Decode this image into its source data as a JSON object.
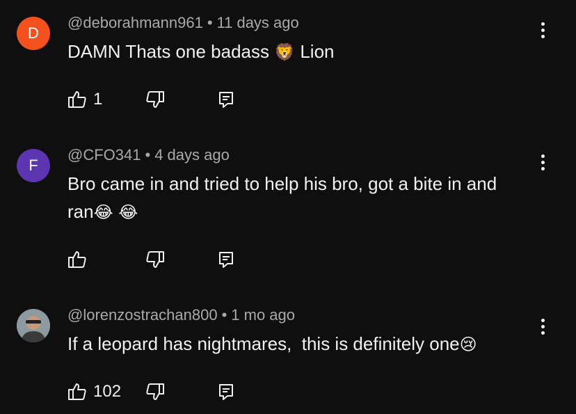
{
  "comments": [
    {
      "avatar_letter": "D",
      "avatar_color": "#f4511e",
      "handle": "@deborahmann961",
      "separator": "•",
      "time": "11 days ago",
      "text_before": "DAMN Thats one badass ",
      "emoji": "🦁",
      "text_after": " Lion",
      "like_count": "1"
    },
    {
      "avatar_letter": "F",
      "avatar_color": "#5e35b1",
      "handle": "@CFO341",
      "separator": "•",
      "time": "4 days ago",
      "text_before": "Bro came in and tried to help his bro, got a bite in and ran",
      "emoji": "😂 😂",
      "text_after": "",
      "like_count": ""
    },
    {
      "avatar_letter": "",
      "avatar_color": "#6b7a80",
      "handle": "@lorenzostrachan800",
      "separator": "•",
      "time": "1 mo ago",
      "text_before": "If a leopard has nightmares,  this is definitely one",
      "emoji": "😢",
      "text_after": "",
      "like_count": "102"
    }
  ],
  "icons": {
    "like": "thumbs-up-icon",
    "dislike": "thumbs-down-icon",
    "reply": "reply-icon",
    "more": "more-vertical-icon"
  }
}
